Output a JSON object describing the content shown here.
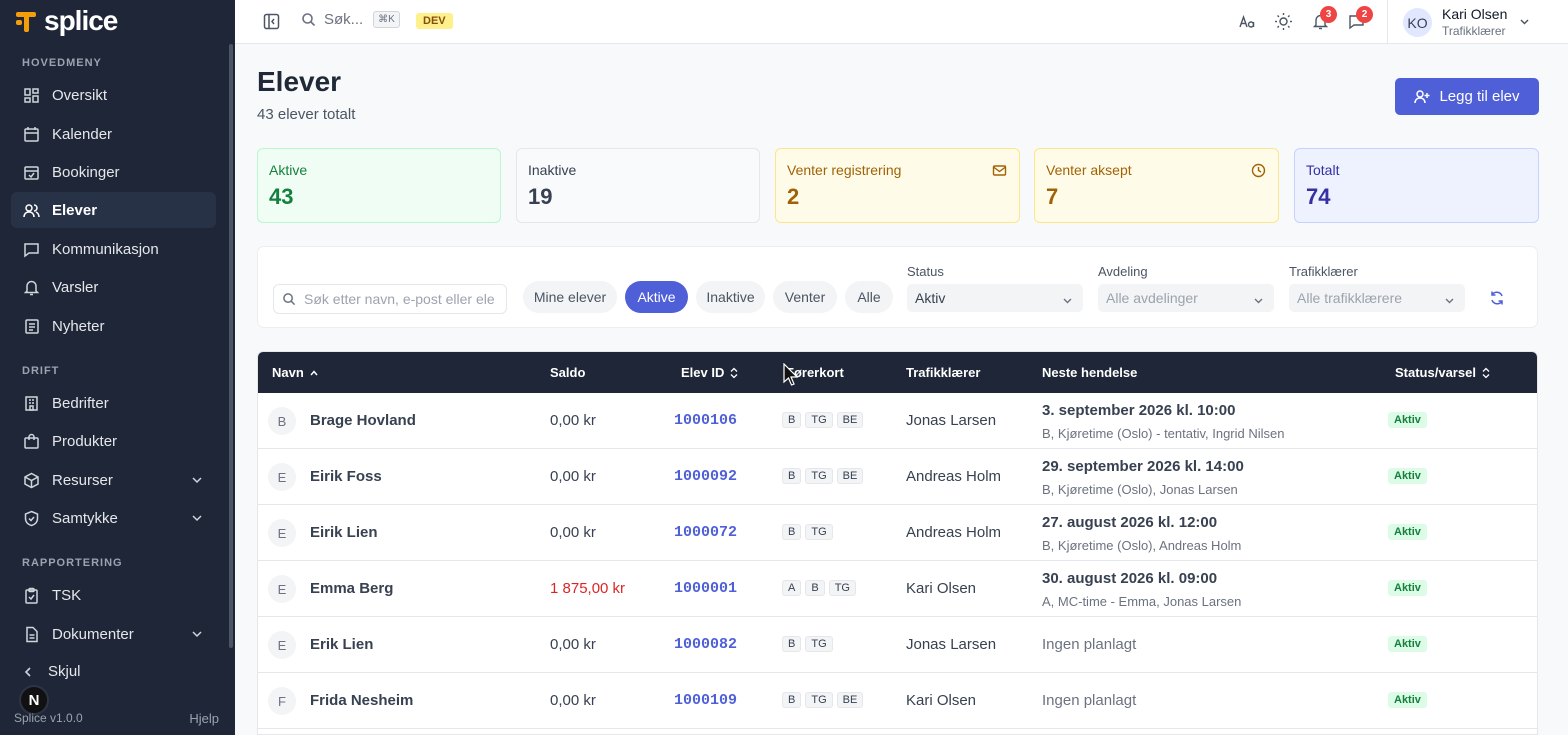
{
  "app": {
    "logo_text": "splice",
    "version": "Splice v1.0.0",
    "help": "Hjelp"
  },
  "sidebar": {
    "sections": {
      "main": "HOVEDMENY",
      "drift": "DRIFT",
      "rapportering": "RAPPORTERING"
    },
    "items": [
      {
        "label": "Oversikt",
        "icon": "grid-icon"
      },
      {
        "label": "Kalender",
        "icon": "calendar-icon"
      },
      {
        "label": "Bookinger",
        "icon": "calendar-check-icon"
      },
      {
        "label": "Elever",
        "icon": "users-icon",
        "active": true
      },
      {
        "label": "Kommunikasjon",
        "icon": "message-icon"
      },
      {
        "label": "Varsler",
        "icon": "bell-icon"
      },
      {
        "label": "Nyheter",
        "icon": "newspaper-icon"
      },
      {
        "label": "Bedrifter",
        "icon": "building-icon"
      },
      {
        "label": "Produkter",
        "icon": "bag-icon"
      },
      {
        "label": "Resurser",
        "icon": "box-icon"
      },
      {
        "label": "Samtykke",
        "icon": "shield-icon"
      },
      {
        "label": "TSK",
        "icon": "clipboard-icon"
      },
      {
        "label": "Dokumenter",
        "icon": "document-icon"
      }
    ],
    "hide_label": "Skjul",
    "n_badge": "N"
  },
  "topbar": {
    "search_label": "Søk...",
    "shortcut": "⌘K",
    "env_badge": "DEV",
    "notifications_count": "3",
    "messages_count": "2",
    "user": {
      "initials": "KO",
      "name": "Kari Olsen",
      "role": "Trafikklærer"
    }
  },
  "page": {
    "title": "Elever",
    "subtitle": "43 elever totalt",
    "add_button": "Legg til elev"
  },
  "stats": [
    {
      "label": "Aktive",
      "value": "43",
      "color": "#15803d"
    },
    {
      "label": "Inaktive",
      "value": "19",
      "color": "#374151"
    },
    {
      "label": "Venter registrering",
      "value": "2",
      "color": "#a16207"
    },
    {
      "label": "Venter aksept",
      "value": "7",
      "color": "#a16207"
    },
    {
      "label": "Totalt",
      "value": "74",
      "color": "#3730a3"
    }
  ],
  "filters": {
    "search_placeholder": "Søk etter navn, e-post eller elev-ID",
    "pills": [
      "Mine elever",
      "Aktive",
      "Inaktive",
      "Venter",
      "Alle"
    ],
    "status_label": "Status",
    "status_value": "Aktiv",
    "department_label": "Avdeling",
    "department_value": "Alle avdelinger",
    "teacher_label": "Trafikklærer",
    "teacher_value": "Alle trafikklærere"
  },
  "table": {
    "columns": [
      "Navn",
      "Saldo",
      "Elev ID",
      "Førerkort",
      "Trafikklærer",
      "Neste hendelse",
      "Status/varsel"
    ],
    "rows": [
      {
        "initial": "B",
        "name": "Brage Hovland",
        "saldo": "0,00 kr",
        "id": "1000106",
        "cards": [
          "B",
          "TG",
          "BE"
        ],
        "teacher": "Jonas Larsen",
        "event": "3. september 2026 kl. 10:00",
        "event_detail": "B, Kjøretime (Oslo) - tentativ, Ingrid Nilsen",
        "status": "Aktiv"
      },
      {
        "initial": "E",
        "name": "Eirik Foss",
        "saldo": "0,00 kr",
        "id": "1000092",
        "cards": [
          "B",
          "TG",
          "BE"
        ],
        "teacher": "Andreas Holm",
        "event": "29. september 2026 kl. 14:00",
        "event_detail": "B, Kjøretime (Oslo), Jonas Larsen",
        "status": "Aktiv"
      },
      {
        "initial": "E",
        "name": "Eirik Lien",
        "saldo": "0,00 kr",
        "id": "1000072",
        "cards": [
          "B",
          "TG"
        ],
        "teacher": "Andreas Holm",
        "event": "27. august 2026 kl. 12:00",
        "event_detail": "B, Kjøretime (Oslo), Andreas Holm",
        "status": "Aktiv"
      },
      {
        "initial": "E",
        "name": "Emma Berg",
        "saldo": "1 875,00 kr",
        "saldo_negative": true,
        "id": "1000001",
        "cards": [
          "A",
          "B",
          "TG"
        ],
        "teacher": "Kari Olsen",
        "event": "30. august 2026 kl. 09:00",
        "event_detail": "A, MC-time - Emma, Jonas Larsen",
        "status": "Aktiv"
      },
      {
        "initial": "E",
        "name": "Erik Lien",
        "saldo": "0,00 kr",
        "id": "1000082",
        "cards": [
          "B",
          "TG"
        ],
        "teacher": "Jonas Larsen",
        "event_none": "Ingen planlagt",
        "status": "Aktiv"
      },
      {
        "initial": "F",
        "name": "Frida Nesheim",
        "saldo": "0,00 kr",
        "id": "1000109",
        "cards": [
          "B",
          "TG",
          "BE"
        ],
        "teacher": "Kari Olsen",
        "event_none": "Ingen planlagt",
        "status": "Aktiv"
      }
    ]
  }
}
